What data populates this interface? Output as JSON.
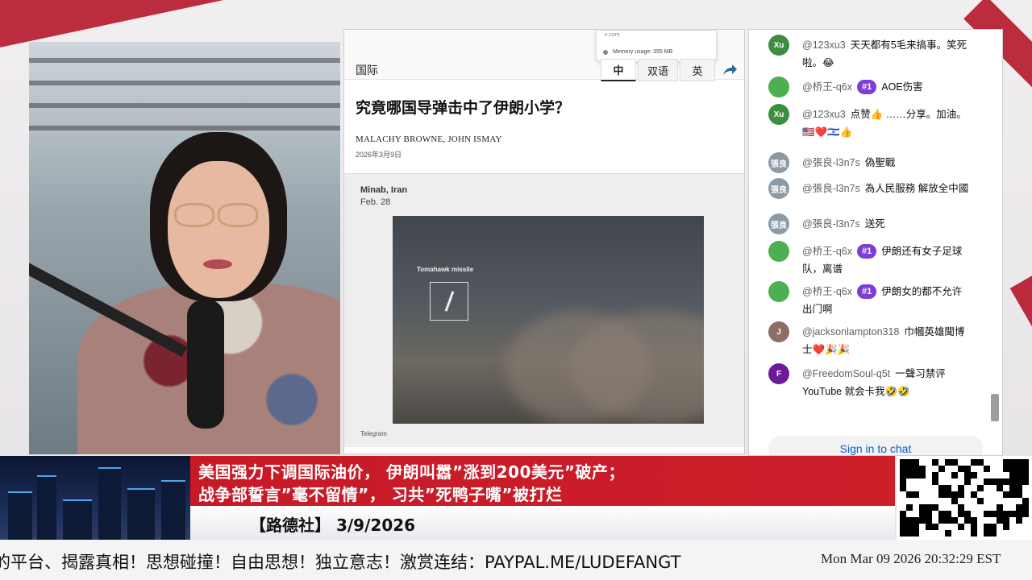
{
  "article": {
    "section": "国际",
    "lang_tabs": [
      "中",
      "双语",
      "英"
    ],
    "active_tab": "中",
    "memory_url": "x.com",
    "memory_usage": "Memory usage: 355 MB",
    "headline": "究竟哪国导弹击中了伊朗小学？",
    "byline": "MALACHY BROWNE, JOHN ISMAY",
    "date": "2026年3月9日",
    "media": {
      "location": "Minab, Iran",
      "location_date": "Feb. 28",
      "annotation": "Tomahawk missile",
      "credit": "Telegram"
    },
    "share_icon": "share-arrow-icon"
  },
  "chat": {
    "messages": [
      {
        "avatar_text": "Xu",
        "avatar_color": "#3e8e41",
        "author": "@123xu3",
        "badge": "",
        "text": "天天都有5毛来搞事。笑死啦。",
        "emoji": "😂"
      },
      {
        "avatar_text": "",
        "avatar_color": "#4caf50",
        "author": "@桥王-q6x",
        "badge": "#1",
        "text": "AOE伤害",
        "emoji": ""
      },
      {
        "avatar_text": "Xu",
        "avatar_color": "#3e8e41",
        "author": "@123xu3",
        "badge": "",
        "text": "点赞👍 ……分享。加油。",
        "emoji": "🇺🇸❤️🇮🇱👍"
      },
      {
        "avatar_text": "張良",
        "avatar_color": "#8a9aa6",
        "author": "@張良-l3n7s",
        "badge": "",
        "text": "偽聖戰",
        "emoji": ""
      },
      {
        "avatar_text": "張良",
        "avatar_color": "#8a9aa6",
        "author": "@張良-l3n7s",
        "badge": "",
        "text": "為人民服務 解放全中國",
        "emoji": ""
      },
      {
        "avatar_text": "張良",
        "avatar_color": "#8a9aa6",
        "author": "@張良-l3n7s",
        "badge": "",
        "text": "送死",
        "emoji": ""
      },
      {
        "avatar_text": "",
        "avatar_color": "#4caf50",
        "author": "@桥王-q6x",
        "badge": "#1",
        "text": "伊朗还有女子足球队，离谱",
        "emoji": ""
      },
      {
        "avatar_text": "",
        "avatar_color": "#4caf50",
        "author": "@桥王-q6x",
        "badge": "#1",
        "text": "伊朗女的都不允许出门啊",
        "emoji": ""
      },
      {
        "avatar_text": "J",
        "avatar_color": "#8d6e63",
        "author": "@jacksonlampton318",
        "badge": "",
        "text": "巾幗英雄聞博士",
        "emoji": "❤️🎉🎉"
      },
      {
        "avatar_text": "F",
        "avatar_color": "#6a1b9a",
        "author": "@FreedomSoul-q5t",
        "badge": "",
        "text": "一聲习禁评YouTube 就会卡我",
        "emoji": "🤣🤣"
      }
    ],
    "signin_label": "Sign in to chat"
  },
  "lower_third": {
    "title_line1": "美国强力下调国际油价， 伊朗叫嚣”涨到200美元”破产；",
    "title_line2": "战争部誓言”毫不留情”， 习共”死鸭子嘴”被打烂",
    "show_label": "【路德社】 3/9/2026"
  },
  "ticker": {
    "text": "的平台、揭露真相！思想碰撞！自由思想！独立意志！激赏连结：PAYPAL.ME/LUDEFANGT",
    "clock": "Mon Mar 09 2026 20:32:29 EST"
  },
  "colors": {
    "accent_red": "#c71a27",
    "badge_purple": "#7b3fd6",
    "link_blue": "#065fd4"
  }
}
